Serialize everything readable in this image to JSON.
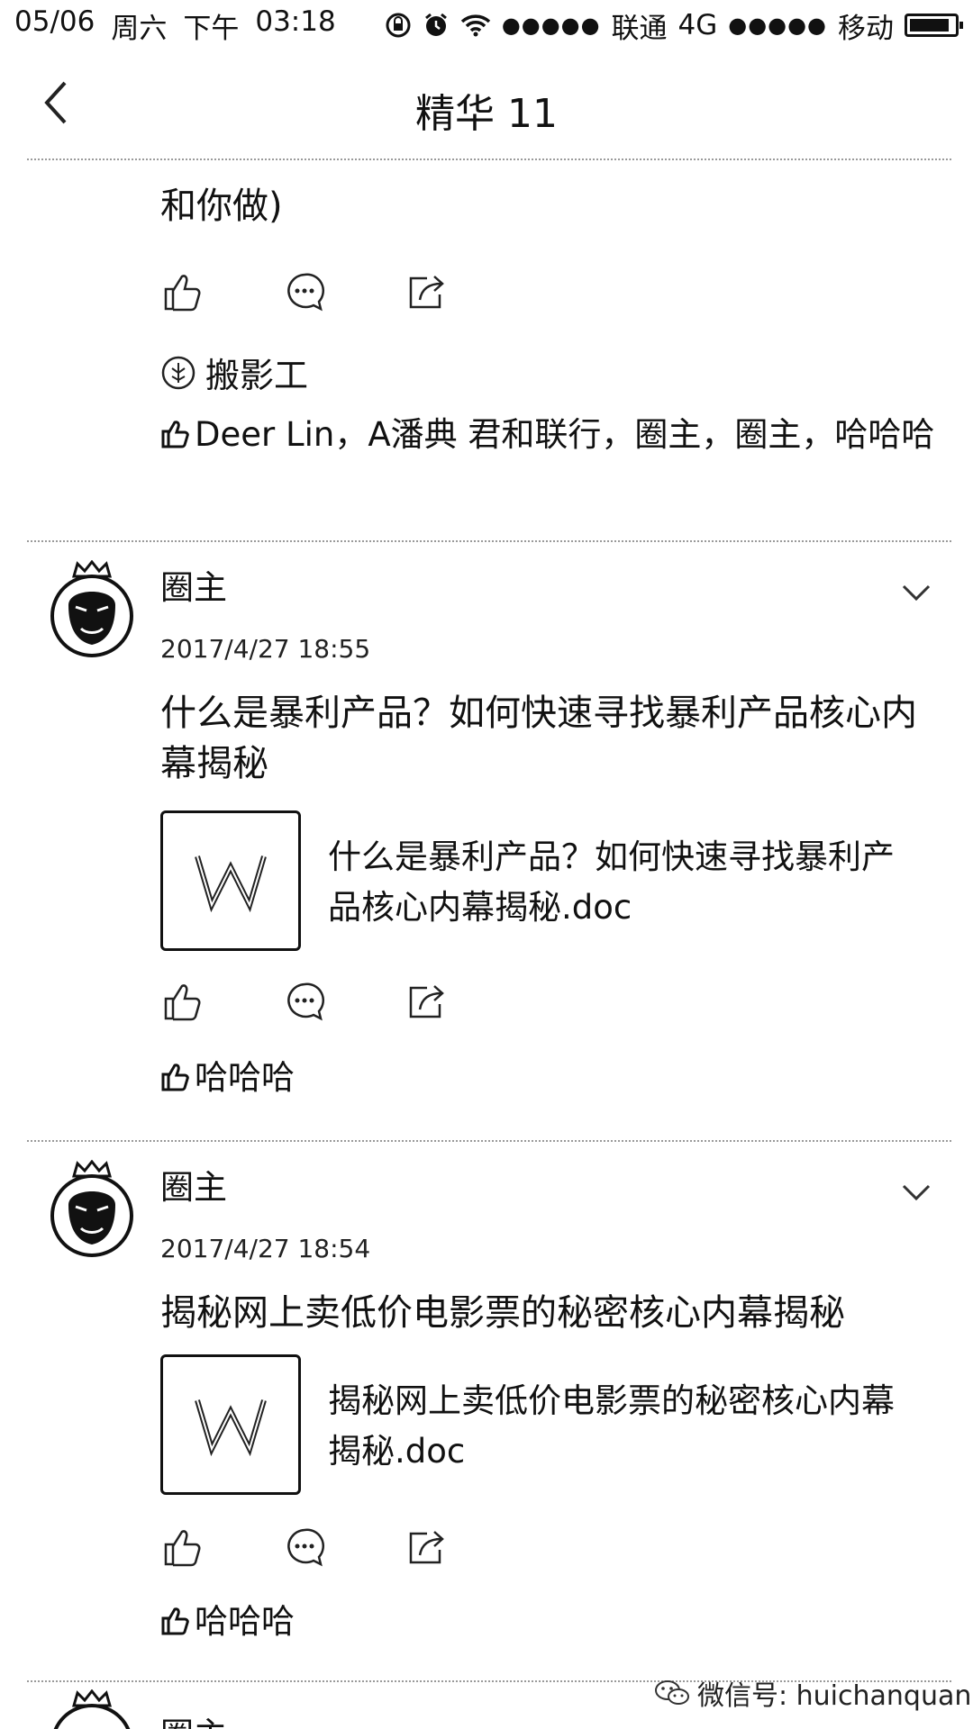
{
  "status_bar": {
    "date": "05/06",
    "weekday": "周六",
    "ampm": "下午",
    "time": "03:18",
    "signal_dots": "●●●●●",
    "carrier1": "联通",
    "network": "4G",
    "signal_dots2": "●●●●●",
    "carrier2": "移动",
    "battery_level": 0.9
  },
  "nav": {
    "title": "精华 11"
  },
  "prev_post": {
    "text_tail": "和你做)",
    "circle_tag": "搬影工",
    "likes": "Deer Lin，A潘典 君和联行，圈主，圈主，哈哈哈"
  },
  "posts": [
    {
      "author": "圈主",
      "time": "2017/4/27 18:55",
      "body": "什么是暴利产品？如何快速寻找暴利产品核心内幕揭秘",
      "attachment": "什么是暴利产品？如何快速寻找暴利产品核心内幕揭秘.doc",
      "likes": "哈哈哈"
    },
    {
      "author": "圈主",
      "time": "2017/4/27 18:54",
      "body": "揭秘网上卖低价电影票的秘密核心内幕揭秘",
      "attachment": "揭秘网上卖低价电影票的秘密核心内幕揭秘.doc",
      "likes": "哈哈哈"
    }
  ],
  "next_post": {
    "author_partial": "圈主"
  },
  "watermark": "微信号: huichanquan",
  "icons": [
    "back-arrow-icon",
    "lock-rotation-icon",
    "alarm-icon",
    "wifi-icon",
    "battery-icon",
    "like-icon",
    "comment-icon",
    "share-icon",
    "circle-tag-icon",
    "word-doc-icon",
    "chevron-down-icon",
    "wechat-icon"
  ]
}
